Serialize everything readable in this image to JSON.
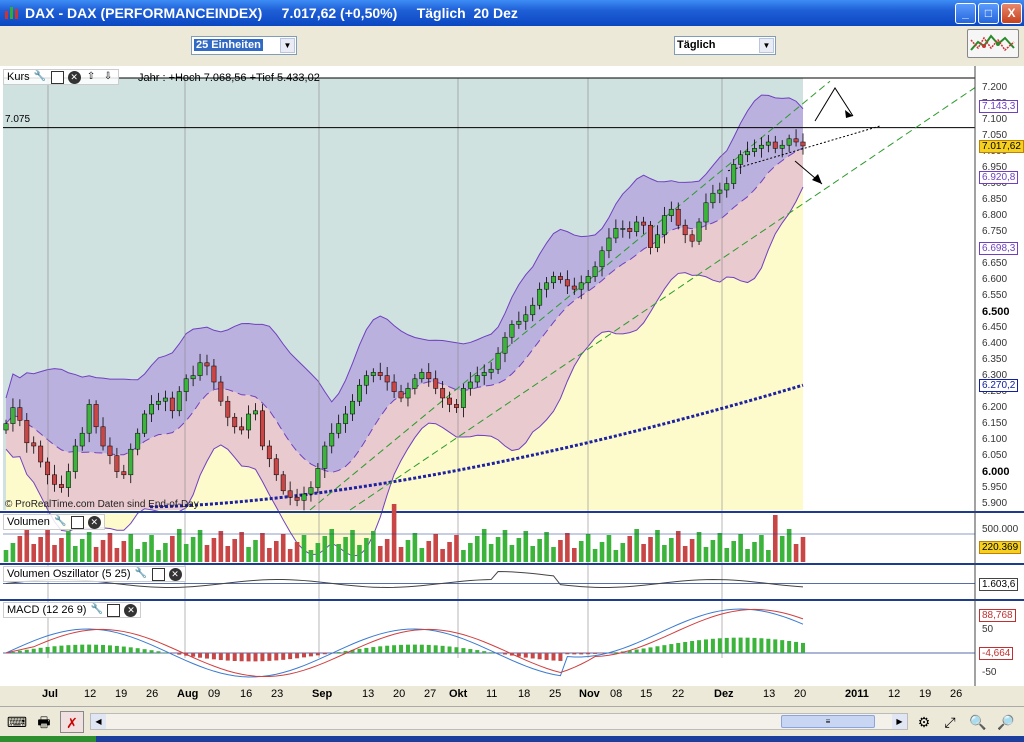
{
  "window": {
    "title": "DAX - DAX (PERFORMANCEINDEX)     7.017,62 (+0,50%)     Täglich  20 Dez",
    "minimize": "_",
    "maximize": "□",
    "close": "X"
  },
  "toolbar": {
    "units_select": "25 Einheiten",
    "period_select": "Täglich"
  },
  "price_panel": {
    "label": "Kurs",
    "year_info": "Jahr : +Hoch 7.068,56 +Tief 5.433,02",
    "hline_label": "7.075",
    "copyright": "© ProRealTime.com  Daten sind End-of-Day",
    "y_ticks": [
      "7.200",
      "7.150",
      "7.100",
      "7.050",
      "7.000",
      "6.950",
      "6.900",
      "6.850",
      "6.800",
      "6.750",
      "6.700",
      "6.650",
      "6.600",
      "6.550",
      "6.500",
      "6.450",
      "6.400",
      "6.350",
      "6.300",
      "6.250",
      "6.200",
      "6.150",
      "6.100",
      "6.050",
      "6.000",
      "5.950",
      "5.900"
    ],
    "value_boxes": [
      {
        "text": "7.143,3",
        "color": "#7040C0"
      },
      {
        "text": "7.017,62",
        "color": "#C08000",
        "fill": "#F5D020"
      },
      {
        "text": "6.920,8",
        "color": "#7040C0"
      },
      {
        "text": "6.698,3",
        "color": "#7040C0"
      },
      {
        "text": "6.270,2",
        "color": "#1020A0"
      }
    ]
  },
  "volume_panel": {
    "label": "Volumen",
    "tick": "500.000",
    "value_box": "220.369"
  },
  "vol_osc_panel": {
    "label": "Volumen Oszillator (5 25)",
    "value_box": "1.603,6"
  },
  "macd_panel": {
    "label": "MACD (12 26 9)",
    "ticks": [
      "50",
      "-50"
    ],
    "value_box_1": "88,768",
    "value_box_2": "-4,664"
  },
  "x_axis": [
    "Jul",
    "12",
    "19",
    "26",
    "Aug",
    "09",
    "16",
    "23",
    "Sep",
    "13",
    "20",
    "27",
    "Okt",
    "11",
    "18",
    "25",
    "Nov",
    "08",
    "15",
    "22",
    "Dez",
    "13",
    "20",
    "2011",
    "12",
    "19",
    "26"
  ],
  "icons": [
    "app-icon",
    "wrench-icon",
    "window-icon",
    "close-icon",
    "up-arrow-icon",
    "down-arrow-icon",
    "chart-type-icon",
    "keyboard-icon",
    "printer-icon",
    "cursor-off-icon",
    "zoom-fit-icon",
    "zoom-out-icon",
    "zoom-in-icon"
  ],
  "chart_data": {
    "type": "candlestick",
    "title": "DAX - DAX (PERFORMANCEINDEX)",
    "ylim": [
      5880,
      7230
    ],
    "last_close": 7017.62,
    "year_high": 7068.56,
    "year_low": 5433.02,
    "horizontal_line": 7075,
    "closes": [
      6150,
      6200,
      6160,
      6090,
      6080,
      6030,
      5990,
      5960,
      5950,
      6000,
      6080,
      6120,
      6210,
      6140,
      6080,
      6050,
      6000,
      5990,
      6070,
      6120,
      6180,
      6210,
      6220,
      6230,
      6190,
      6250,
      6290,
      6300,
      6340,
      6330,
      6280,
      6220,
      6170,
      6140,
      6130,
      6180,
      6190,
      6080,
      6040,
      5990,
      5940,
      5920,
      5910,
      5930,
      5950,
      6010,
      6080,
      6120,
      6150,
      6180,
      6220,
      6270,
      6300,
      6310,
      6300,
      6280,
      6250,
      6230,
      6260,
      6290,
      6310,
      6290,
      6260,
      6230,
      6210,
      6200,
      6260,
      6280,
      6300,
      6310,
      6320,
      6370,
      6420,
      6460,
      6470,
      6490,
      6520,
      6570,
      6590,
      6610,
      6600,
      6580,
      6570,
      6590,
      6610,
      6640,
      6690,
      6730,
      6760,
      6760,
      6750,
      6780,
      6770,
      6700,
      6740,
      6800,
      6820,
      6770,
      6740,
      6720,
      6780,
      6840,
      6870,
      6880,
      6900,
      6960,
      6990,
      7000,
      7010,
      7020,
      7030,
      7010,
      7020,
      7040,
      7030,
      7017.62
    ],
    "ma_long_end": 6270.2,
    "bollinger_upper_end": 7143.3,
    "bollinger_mid_end": 6920.8,
    "bollinger_lower_end": 6698.3
  }
}
